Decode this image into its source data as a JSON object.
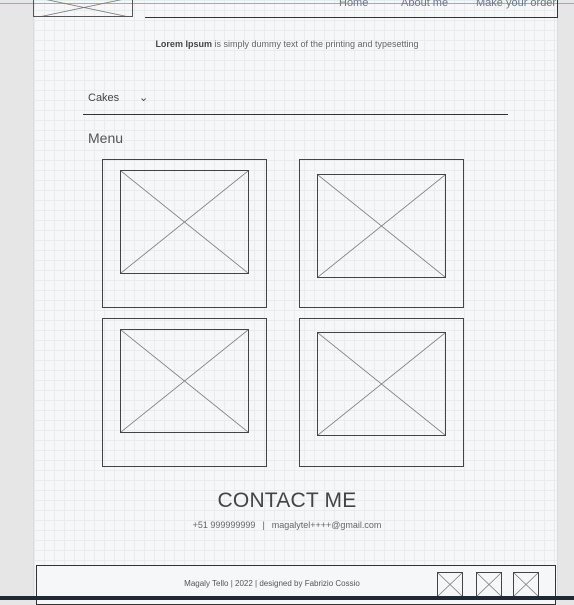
{
  "header": {
    "nav": [
      "Home",
      "About me",
      "Make your order"
    ]
  },
  "tagline": {
    "bold": "Lorem Ipsum",
    "rest": " is simply dummy text of the printing and typesetting"
  },
  "filter": {
    "selected": "Cakes",
    "chevron": "⌄"
  },
  "menu": {
    "title": "Menu",
    "items": [
      {
        "icon": "image-placeholder-icon"
      },
      {
        "icon": "image-placeholder-icon"
      },
      {
        "icon": "image-placeholder-icon"
      },
      {
        "icon": "image-placeholder-icon"
      }
    ]
  },
  "contact": {
    "title": "CONTACT ME",
    "phone": "+51 999999999",
    "separator": "|",
    "email": "magalytel++++@gmail.com"
  },
  "footer": {
    "credit": "Magaly Tello | 2022 | designed by Fabrizio Cossio",
    "social": [
      "image-placeholder-icon",
      "image-placeholder-icon",
      "image-placeholder-icon"
    ]
  },
  "colors": {
    "grid_background": "#f6f7f8",
    "outline": "#444444",
    "guide": "#8aa8ff",
    "bottom_bar": "#1e2933"
  }
}
